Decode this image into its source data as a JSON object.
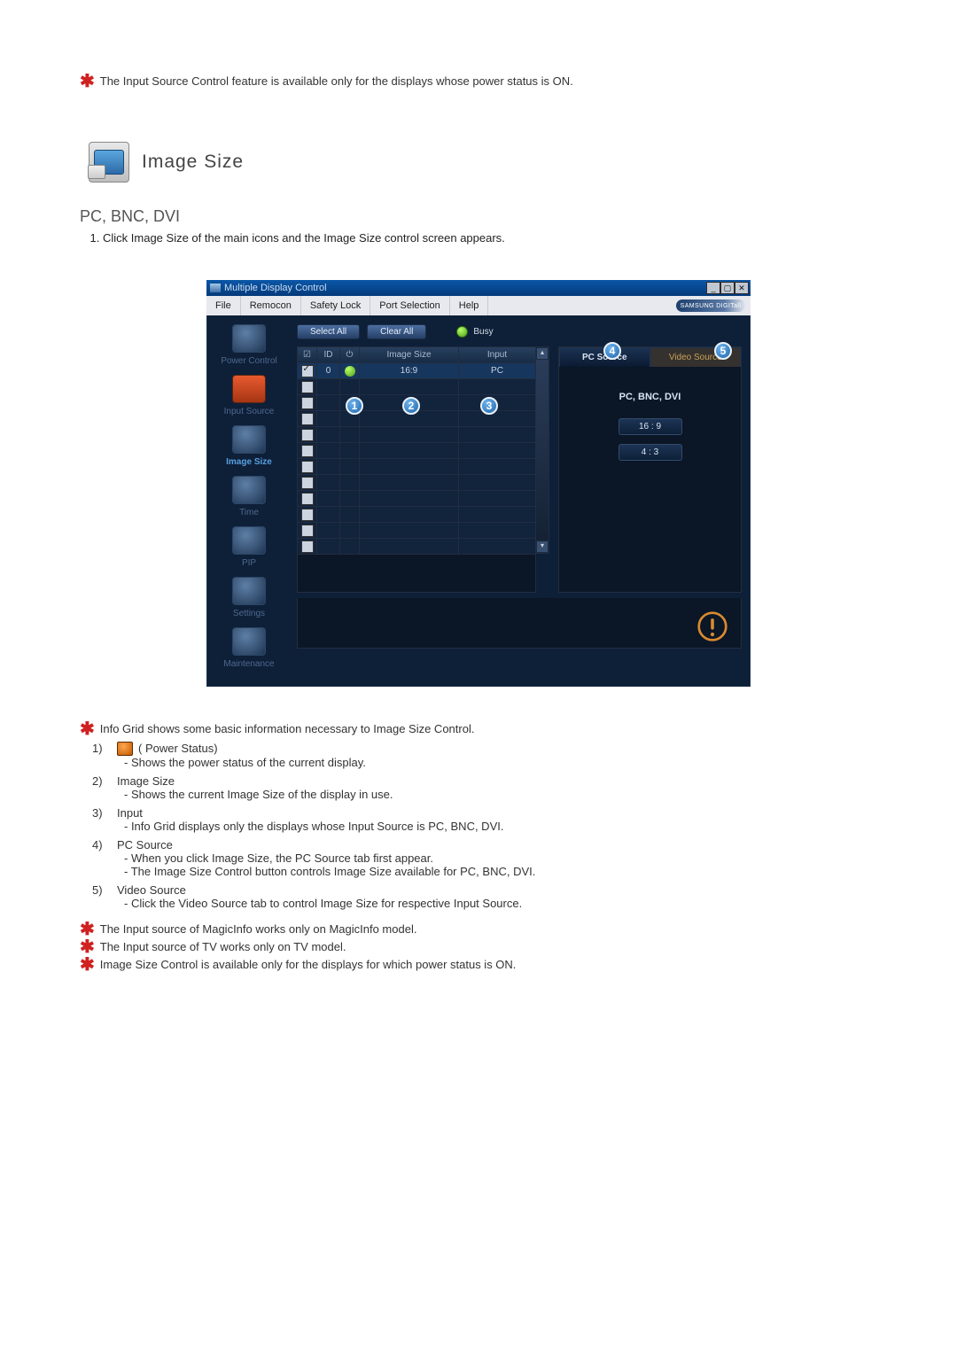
{
  "top_note": "The Input Source Control feature is available only for the displays whose power status is ON.",
  "section_title": "Image Size",
  "subhead": "PC, BNC, DVI",
  "instruction_1": "Click Image Size of the main icons and the Image Size control screen appears.",
  "app": {
    "title": "Multiple Display Control",
    "win_min": "_",
    "win_max": "▢",
    "win_close": "✕",
    "menu": {
      "file": "File",
      "remocon": "Remocon",
      "safety": "Safety Lock",
      "port": "Port Selection",
      "help": "Help"
    },
    "brand": "SAMSUNG DIGITall",
    "sidebar": {
      "power": "Power Control",
      "input": "Input Source",
      "image_size": "Image Size",
      "time": "Time",
      "pip": "PIP",
      "settings": "Settings",
      "maint": "Maintenance"
    },
    "buttons": {
      "select_all": "Select All",
      "clear_all": "Clear All"
    },
    "busy_label": "Busy",
    "grid": {
      "head_cb": "☑",
      "head_id": "ID",
      "head_status": "⏻",
      "head_size": "Image Size",
      "head_input": "Input",
      "row0": {
        "id": "0",
        "size": "16:9",
        "input": "PC"
      }
    },
    "scroll_up": "▴",
    "scroll_down": "▾",
    "right": {
      "tab_pc": "PC Source",
      "tab_video": "Video Source",
      "panel_label": "PC, BNC, DVI",
      "ratio_169": "16 : 9",
      "ratio_43": "4 : 3"
    },
    "badges": {
      "b1": "1",
      "b2": "2",
      "b3": "3",
      "b4": "4",
      "b5": "5"
    }
  },
  "note_info_grid": "Info Grid shows some basic information necessary to Image Size Control.",
  "items": {
    "n1": "1)",
    "n1_label": "( Power Status)",
    "n1_sub": "- Shows the power status of the current display.",
    "n2": "2)",
    "n2_label": "Image Size",
    "n2_sub": "- Shows the current Image Size of the display in use.",
    "n3": "3)",
    "n3_label": "Input",
    "n3_sub": "- Info Grid displays only the displays whose Input Source is PC, BNC, DVI.",
    "n4": "4)",
    "n4_label": "PC Source",
    "n4_sub_a": "- When you click Image Size, the PC Source tab first appear.",
    "n4_sub_b": "- The Image Size Control button controls Image Size available for PC, BNC, DVI.",
    "n5": "5)",
    "n5_label": "Video Source",
    "n5_sub": "- Click the Video Source tab to control Image Size for respective Input Source."
  },
  "footnotes": {
    "a": "The Input source of MagicInfo works only on MagicInfo model.",
    "b": "The Input source of TV works only on TV model.",
    "c": "Image Size Control is available only for the displays for which power status is ON."
  }
}
